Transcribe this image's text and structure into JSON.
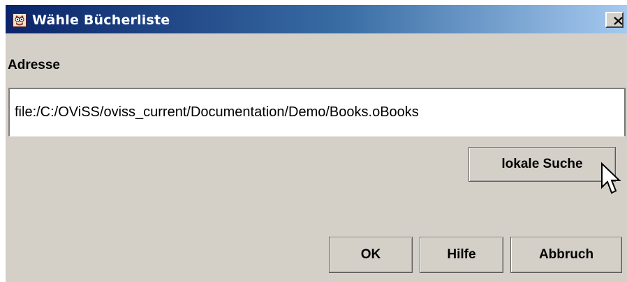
{
  "window": {
    "title": "Wähle Bücherliste",
    "close_label": "close"
  },
  "address": {
    "label": "Adresse",
    "value": "file:/C:/OViSS/oviss_current/Documentation/Demo/Books.oBooks"
  },
  "buttons": {
    "local_search": "lokale Suche",
    "ok": "OK",
    "help": "Hilfe",
    "cancel": "Abbruch"
  },
  "colors": {
    "dialog_background": "#d4d0c8",
    "titlebar_start": "#0a246a",
    "titlebar_end": "#a6caf0"
  }
}
